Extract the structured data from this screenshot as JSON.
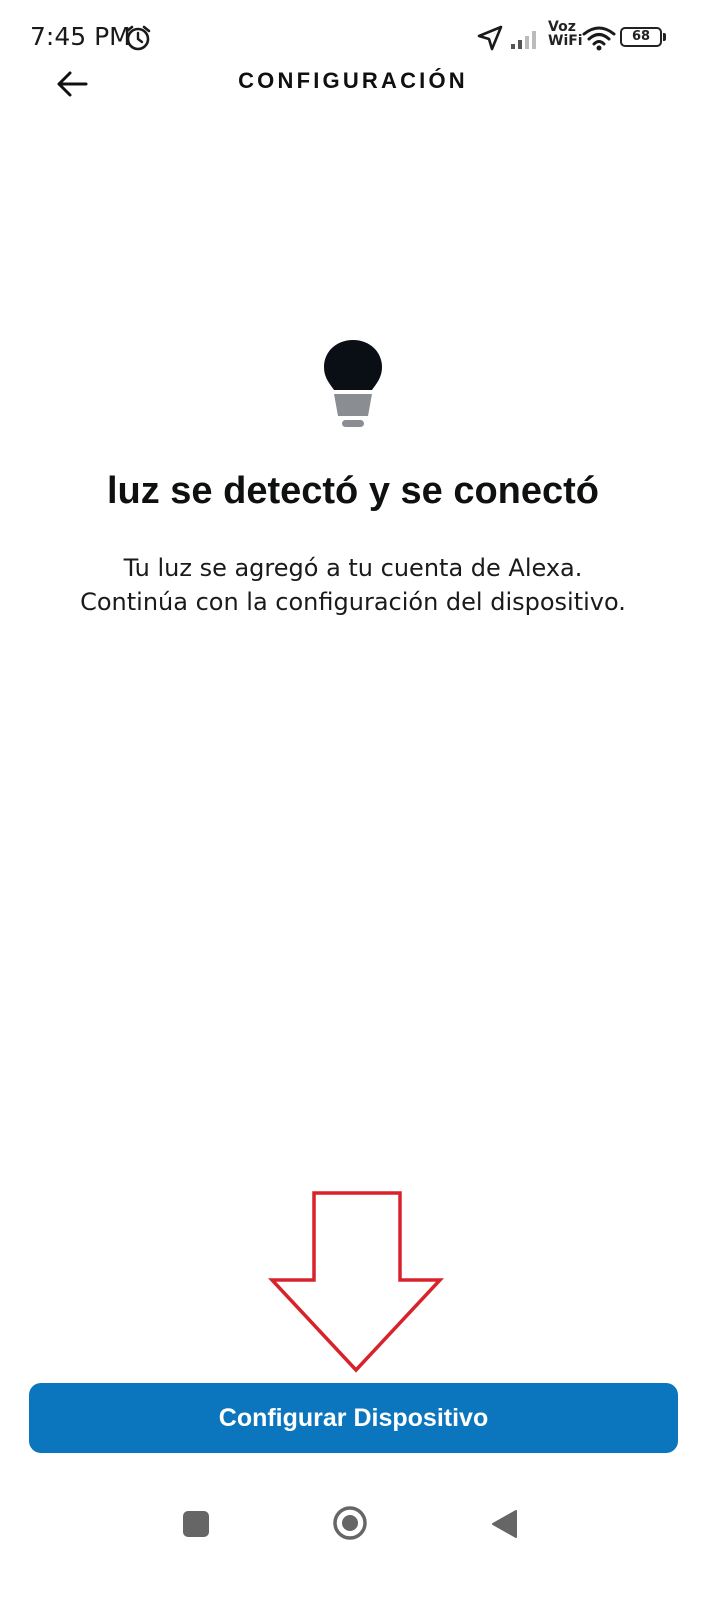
{
  "status_bar": {
    "time": "7:45 PM",
    "voz_line1": "Voz",
    "voz_line2": "WiFi",
    "battery": "68",
    "icons": [
      "alarm-icon",
      "location-arrow-icon",
      "cellular-signal-icon",
      "wifi-icon",
      "battery-icon"
    ]
  },
  "header": {
    "title": "CONFIGURACIÓN",
    "back_icon": "arrow-left-icon"
  },
  "content": {
    "icon": "light-bulb-icon",
    "title": "luz se detectó y se conectó",
    "description_line1": "Tu luz se agregó a tu cuenta de Alexa.",
    "description_line2": "Continúa con la configuración del dispositivo."
  },
  "annotation": {
    "icon": "down-arrow-outline-icon",
    "color": "#d8232a"
  },
  "primary_button": {
    "label": "Configurar Dispositivo",
    "color": "#0b75be"
  },
  "nav_bar": {
    "icons": [
      "recents-square-icon",
      "home-circle-icon",
      "back-triangle-icon"
    ]
  }
}
